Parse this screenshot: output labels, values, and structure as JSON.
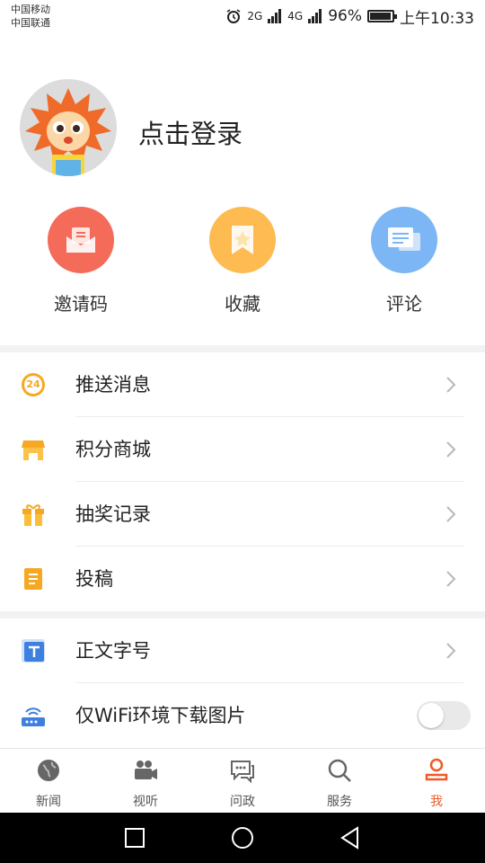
{
  "status_bar": {
    "carrier1": "中国移动",
    "carrier2": "中国联通",
    "net1": "2G",
    "net2": "4G",
    "battery": "96%",
    "battery_level": 0.96,
    "time": "上午10:33"
  },
  "profile": {
    "login": "点击登录"
  },
  "quick_actions": [
    {
      "label": "邀请码",
      "color": "#f46b5a"
    },
    {
      "label": "收藏",
      "color": "#fdbb52"
    },
    {
      "label": "评论",
      "color": "#7db6f5"
    }
  ],
  "menu": {
    "push": "推送消息",
    "push_badge": "24",
    "mall": "积分商城",
    "lottery": "抽奖记录",
    "submit": "投稿",
    "font": "正文字号",
    "wifi": "仅WiFi环境下载图片",
    "wifi_toggle": "off"
  },
  "tabs": [
    {
      "label": "新闻"
    },
    {
      "label": "视听"
    },
    {
      "label": "问政"
    },
    {
      "label": "服务"
    },
    {
      "label": "我"
    }
  ],
  "colors": {
    "accent": "#f05a28",
    "orange": "#f7a823",
    "blue": "#3f7fe0"
  }
}
